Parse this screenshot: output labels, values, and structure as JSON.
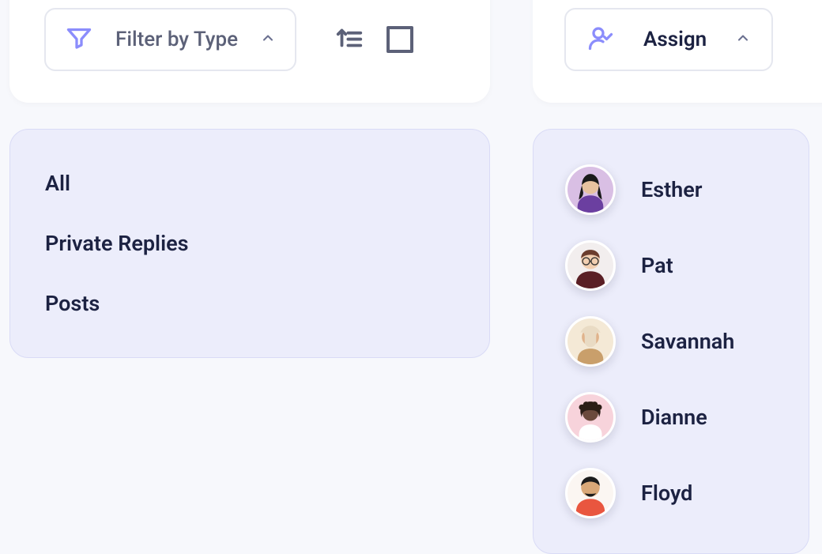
{
  "filter": {
    "label": "Filter by Type",
    "options": [
      "All",
      "Private Replies",
      "Posts"
    ]
  },
  "assign": {
    "label": "Assign",
    "users": [
      {
        "name": "Esther",
        "avatar_bg": "#d9bfe4",
        "avatar_fg": "#6b3fa0",
        "hair": "#1a1a1a"
      },
      {
        "name": "Pat",
        "avatar_bg": "#f2eeee",
        "avatar_fg": "#5a1f25",
        "hair": "#6b3d2e"
      },
      {
        "name": "Savannah",
        "avatar_bg": "#f4e9d6",
        "avatar_fg": "#c99f6b",
        "hair": "#3b2a1e"
      },
      {
        "name": "Dianne",
        "avatar_bg": "#f7d3db",
        "avatar_fg": "#6b4a3c",
        "hair": "#2b1e16"
      },
      {
        "name": "Floyd",
        "avatar_bg": "#fbf6f2",
        "avatar_fg": "#e9563f",
        "hair": "#1c1c1c"
      }
    ]
  },
  "icons": {
    "filter": "filter-icon",
    "sort": "sort-icon",
    "stop": "stop-icon",
    "person": "person-check-icon",
    "chevron": "chevron-up-icon"
  }
}
